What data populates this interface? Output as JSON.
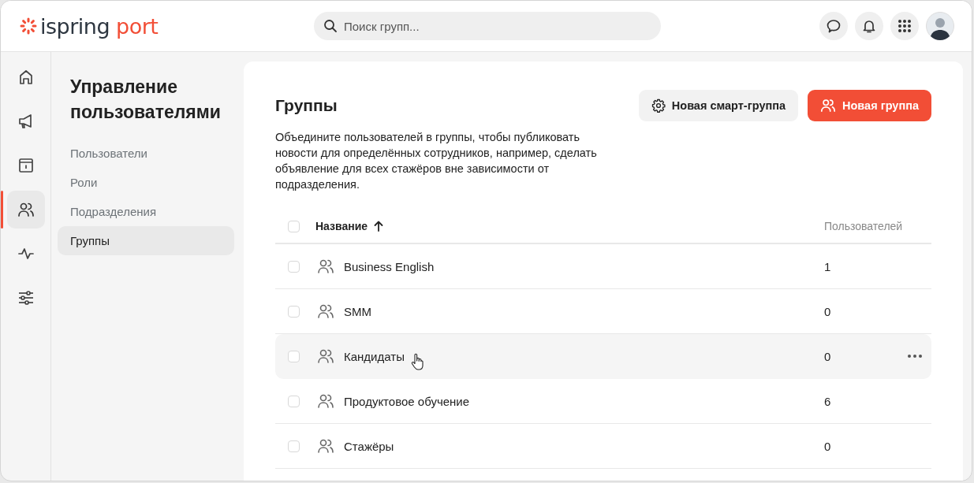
{
  "header": {
    "logo": {
      "word": "ispring",
      "accent": "port"
    },
    "search": {
      "placeholder": "Поиск групп..."
    }
  },
  "rail": [
    {
      "kind": "home",
      "selected": false
    },
    {
      "kind": "megaphone",
      "selected": false
    },
    {
      "kind": "info",
      "selected": false
    },
    {
      "kind": "users",
      "selected": true
    },
    {
      "kind": "pulse",
      "selected": false
    },
    {
      "kind": "sliders",
      "selected": false
    }
  ],
  "sidebar": {
    "title": "Управление пользователями",
    "items": [
      {
        "label": "Пользователи",
        "selected": false
      },
      {
        "label": "Роли",
        "selected": false
      },
      {
        "label": "Подразделения",
        "selected": false
      },
      {
        "label": "Группы",
        "selected": true
      }
    ]
  },
  "main": {
    "title": "Группы",
    "description": "Объедините пользователей в группы, чтобы публиковать новости для определённых сотрудников, например, сделать объявление для всех стажёров вне зависимости от подразделения.",
    "buttons": [
      {
        "label": "Новая смарт-группа",
        "kind": "secondary"
      },
      {
        "label": "Новая группа",
        "kind": "primary"
      }
    ],
    "table": {
      "columns": [
        "Название",
        "Пользователей"
      ],
      "all_checked": false,
      "rows": [
        {
          "name": "Business English",
          "users": "1",
          "checked": false,
          "hovered": false
        },
        {
          "name": "SMM",
          "users": "0",
          "checked": false,
          "hovered": false
        },
        {
          "name": "Кандидаты",
          "users": "0",
          "checked": false,
          "hovered": true
        },
        {
          "name": "Продуктовое обучение",
          "users": "6",
          "checked": false,
          "hovered": false
        },
        {
          "name": "Стажёры",
          "users": "0",
          "checked": false,
          "hovered": false
        }
      ]
    }
  }
}
